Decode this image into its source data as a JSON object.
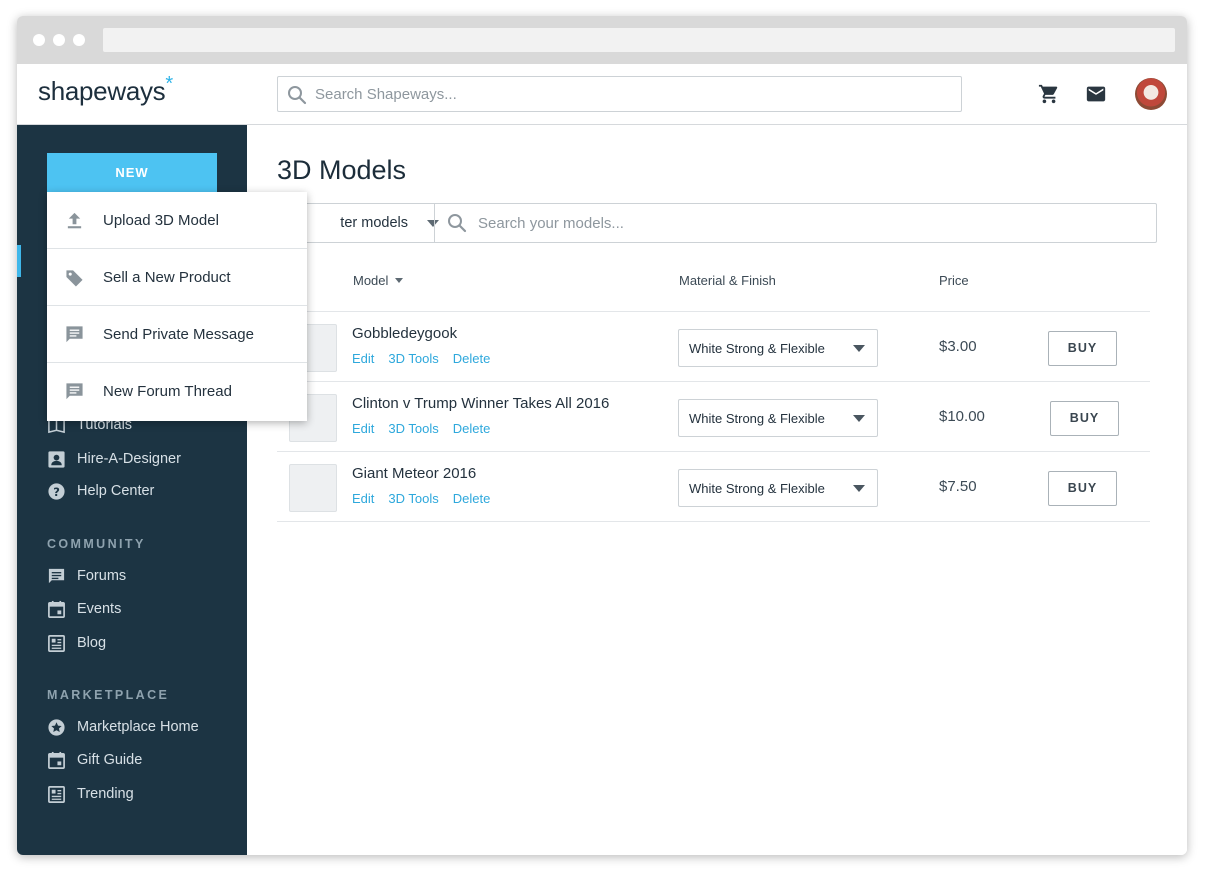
{
  "header": {
    "logo": "shapeways",
    "logo_mark": "*",
    "search_placeholder": "Search Shapeways...",
    "icons": [
      "cart-icon",
      "mail-icon",
      "avatar"
    ]
  },
  "sidebar": {
    "new_button": "NEW",
    "items_top": [
      {
        "label": "Tutorials",
        "icon": "book-icon"
      },
      {
        "label": "Hire-A-Designer",
        "icon": "person-icon"
      },
      {
        "label": "Help Center",
        "icon": "help-icon"
      }
    ],
    "community": {
      "heading": "COMMUNITY",
      "items": [
        {
          "label": "Forums",
          "icon": "chat-icon"
        },
        {
          "label": "Events",
          "icon": "calendar-icon"
        },
        {
          "label": "Blog",
          "icon": "newspaper-icon"
        }
      ]
    },
    "marketplace": {
      "heading": "MARKETPLACE",
      "items": [
        {
          "label": "Marketplace Home",
          "icon": "star-icon"
        },
        {
          "label": "Gift Guide",
          "icon": "calendar-icon"
        },
        {
          "label": "Trending",
          "icon": "newspaper-icon"
        }
      ]
    }
  },
  "new_menu": {
    "items": [
      {
        "label": "Upload 3D Model",
        "icon": "upload-icon"
      },
      {
        "label": "Sell a New Product",
        "icon": "tag-icon"
      },
      {
        "label": "Send Private Message",
        "icon": "message-icon"
      },
      {
        "label": "New Forum Thread",
        "icon": "message-icon"
      }
    ]
  },
  "main": {
    "title": "3D Models",
    "filter_label": "ter models",
    "search_placeholder": "Search your models...",
    "columns": {
      "model": "Model",
      "material": "Material & Finish",
      "price": "Price"
    },
    "row_actions": {
      "edit": "Edit",
      "tools": "3D Tools",
      "delete": "Delete"
    },
    "buy_label": "BUY",
    "models": [
      {
        "name": "Gobbledeygook",
        "material": "White Strong & Flexible",
        "price": "$3.00"
      },
      {
        "name": "Clinton v Trump Winner Takes All 2016",
        "material": "White Strong & Flexible",
        "price": "$10.00"
      },
      {
        "name": "Giant Meteor 2016",
        "material": "White Strong & Flexible",
        "price": "$7.50"
      }
    ]
  },
  "colors": {
    "sidebar": "#1c3443",
    "accent": "#4dc3f2",
    "link": "#2ea8dc"
  }
}
